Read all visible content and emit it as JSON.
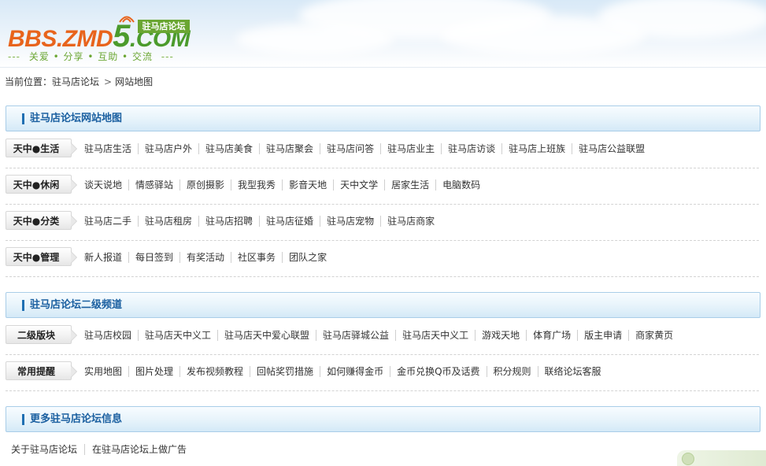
{
  "header": {
    "logo_part1": "BBS.ZMD",
    "logo_part2": "5",
    "logo_part3": ".COM",
    "logo_badge": "驻马店论坛",
    "slogan": "关爱 • 分享 • 互助 • 交流",
    "slogan_dash": "---"
  },
  "breadcrumb": {
    "label": "当前位置：",
    "home": "驻马店论坛",
    "separator": ">",
    "current": "网站地图"
  },
  "sections": [
    {
      "title": "驻马店论坛网站地图",
      "rows": [
        {
          "tag": "天中●生活",
          "links": [
            "驻马店生活",
            "驻马店户外",
            "驻马店美食",
            "驻马店聚会",
            "驻马店问答",
            "驻马店业主",
            "驻马店访谈",
            "驻马店上班族",
            "驻马店公益联盟"
          ]
        },
        {
          "tag": "天中●休闲",
          "links": [
            "谈天说地",
            "情感驿站",
            "原创摄影",
            "我型我秀",
            "影音天地",
            "天中文学",
            "居家生活",
            "电脑数码"
          ]
        },
        {
          "tag": "天中●分类",
          "links": [
            "驻马店二手",
            "驻马店租房",
            "驻马店招聘",
            "驻马店征婚",
            "驻马店宠物",
            "驻马店商家"
          ]
        },
        {
          "tag": "天中●管理",
          "links": [
            "新人报道",
            "每日签到",
            "有奖活动",
            "社区事务",
            "团队之家"
          ]
        }
      ]
    },
    {
      "title": "驻马店论坛二级频道",
      "rows": [
        {
          "tag": "二级版块",
          "links": [
            "驻马店校园",
            "驻马店天中义工",
            "驻马店天中爱心联盟",
            "驻马店驿城公益",
            "驻马店天中义工",
            "游戏天地",
            "体育广场",
            "版主申请",
            "商家黄页"
          ]
        },
        {
          "tag": "常用提醒",
          "links": [
            "实用地图",
            "图片处理",
            "发布视频教程",
            "回帖奖罚措施",
            "如何赚得金币",
            "金币兑换Q币及话费",
            "积分规则",
            "联络论坛客服"
          ]
        }
      ]
    },
    {
      "title": "更多驻马店论坛信息",
      "links": [
        "关于驻马店论坛",
        "在驻马店论坛上做广告"
      ]
    }
  ],
  "colors": {
    "accent": "#1a5fa0",
    "section_border": "#a9cde8",
    "logo_orange": "#e8641c",
    "logo_green": "#4b9b2c"
  }
}
